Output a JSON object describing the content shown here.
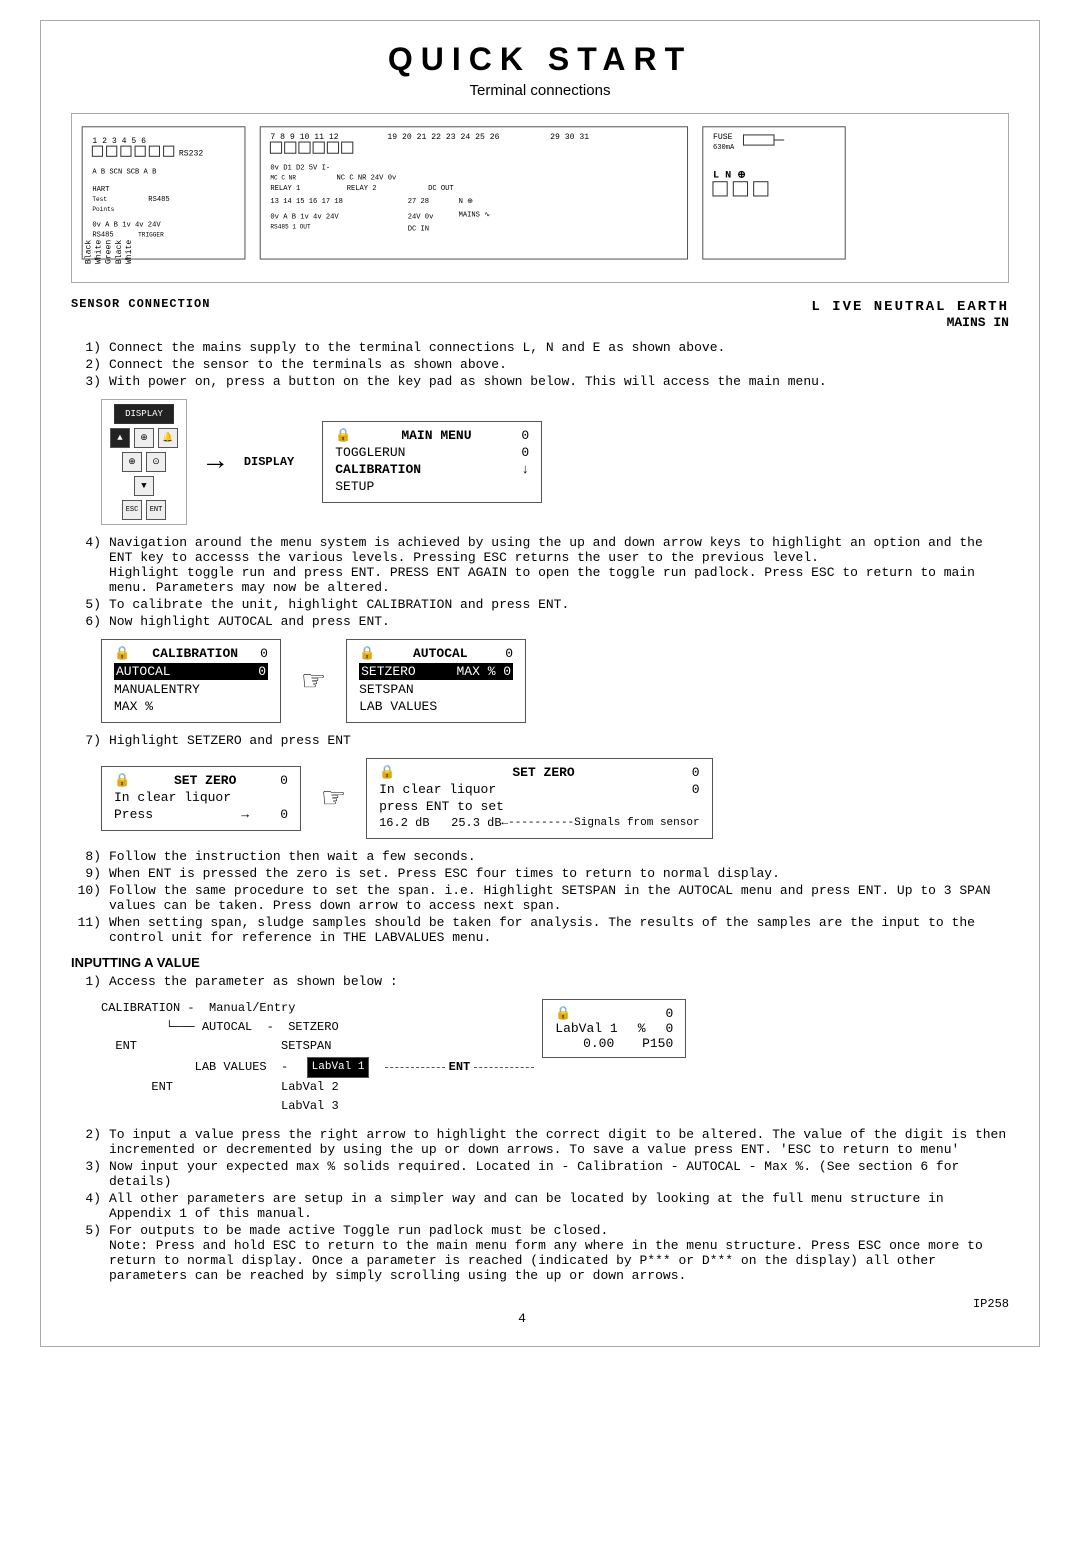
{
  "page": {
    "title": "QUICK  START",
    "subtitle": "Terminal connections",
    "doc_number": "IP258",
    "page_number": "4"
  },
  "sensor_label": "SENSOR CONNECTION",
  "live_neutral": "L IVE  NEUTRAL  EARTH",
  "mains_in": "MAINS IN",
  "steps_1_3": [
    {
      "num": "1)",
      "text": "Connect the mains supply to the terminal connections L, N and E as shown above."
    },
    {
      "num": "2)",
      "text": "Connect the sensor to the terminals as shown above."
    },
    {
      "num": "3)",
      "text": "With power on, press a button on the key pad as shown below. This will access the main menu."
    }
  ],
  "display_label": "DISPLAY",
  "main_menu_panel": {
    "rows": [
      {
        "label": "MAIN MENU",
        "val": "0"
      },
      {
        "label": "TOGGLERUN",
        "val": "0",
        "highlighted": false
      },
      {
        "label": "CALIBRATION",
        "val": "↓"
      },
      {
        "label": "SETUP",
        "val": ""
      }
    ]
  },
  "step4_text": "Navigation around the menu system is achieved by using the up and down arrow keys to highlight an option and the ENT key to accesss the various levels. Pressing ESC returns the user to the previous level.",
  "step4_text2": "Highlight toggle run and press ENT. PRESS ENT AGAIN to open the toggle run padlock.  Press ESC to return to main menu. Parameters may now be altered.",
  "step5_text": "To calibrate the unit, highlight CALIBRATION and press ENT.",
  "step6_text": "Now highlight AUTOCAL and press ENT.",
  "calibration_panel": {
    "title": "CALIBRATION",
    "val": "0",
    "rows": [
      {
        "label": "AUTOCAL",
        "val": "0",
        "highlighted": true
      },
      {
        "label": "MANUALENTRY",
        "val": ""
      },
      {
        "label": "MAX %",
        "val": ""
      }
    ]
  },
  "autocal_panel": {
    "title": "AUTOCAL",
    "val": "0",
    "rows": [
      {
        "label": "SETZERO",
        "val": "",
        "extra": "MAX %  0",
        "highlighted": true
      },
      {
        "label": "SETSPAN",
        "val": ""
      },
      {
        "label": "LAB VALUES",
        "val": ""
      }
    ]
  },
  "step7_text": "Highlight SETZERO and press ENT",
  "setzero_panel1": {
    "title": "SET ZERO",
    "val": "0",
    "rows": [
      {
        "label": "In clear liquor",
        "val": ""
      },
      {
        "label": "Press",
        "val": "→    0"
      }
    ]
  },
  "setzero_panel2": {
    "title": "SET ZERO",
    "val": "0",
    "rows": [
      {
        "label": "In clear liquor",
        "val": "0"
      },
      {
        "label": "press ENT to set",
        "val": ""
      }
    ],
    "signal_row": "16.2 dB     25.3 dB",
    "signal_note": "←----------Signals from sensor"
  },
  "steps_8_11": [
    {
      "num": "8)",
      "text": "Follow the instruction then wait a few seconds."
    },
    {
      "num": "9)",
      "text": "When ENT is pressed the zero is set. Press ESC four times to return to normal display."
    },
    {
      "num": "10)",
      "text": "Follow the same procedure to set the span. i.e. Highlight SETSPAN in the AUTOCAL menu and press ENT. Up to 3 SPAN values can be taken.  Press down arrow to access next span."
    },
    {
      "num": "11)",
      "text": "When setting span, sludge samples should be taken for analysis. The results of the samples are the input to the control unit for reference in THE LABVALUES menu."
    }
  ],
  "inputting_label": "INPUTTING A VALUE",
  "inputting_step1": "Access the parameter as shown below :",
  "cal_tree_lines": [
    "CALIBRATION -   Manual/Entry",
    "       └─── AUTOCAL  -   SETZERO",
    "  ENT                    SETSPAN",
    "              LAB VALUES  -  LabVal 1  ─────ENT─────",
    "         ENT               LabVal 2",
    "                           LabVal 3"
  ],
  "labval_panel": {
    "rows": [
      {
        "label": "",
        "val": "0"
      },
      {
        "label": "LabVal 1",
        "pct": "%",
        "val": "0"
      },
      {
        "label": "",
        "val2": "0.00",
        "val3": "P150"
      }
    ]
  },
  "steps_2_5": [
    {
      "num": "2)",
      "text": "To input a value press the right arrow to highlight the correct digit to be altered. The value of the digit is then incremented or decremented by using the up or down arrows. To save a value press ENT. 'ESC to return to menu'"
    },
    {
      "num": "3)",
      "text": "Now input your expected max % solids required. Located in - Calibration - AUTOCAL - Max %. (See section 6 for details)"
    },
    {
      "num": "4)",
      "text": "All other parameters are setup in a simpler way and can be located by looking at the full menu structure in Appendix 1 of this manual."
    },
    {
      "num": "5)",
      "text": "For outputs to be made active Toggle run padlock must be closed.\nNote: Press and hold ESC to return to the main menu form any where in the menu structure. Press ESC once more to return to normal display.  Once a parameter is reached (indicated by P*** or D*** on the display) all other parameters can be reached by simply scrolling using the up or down arrows."
    }
  ]
}
